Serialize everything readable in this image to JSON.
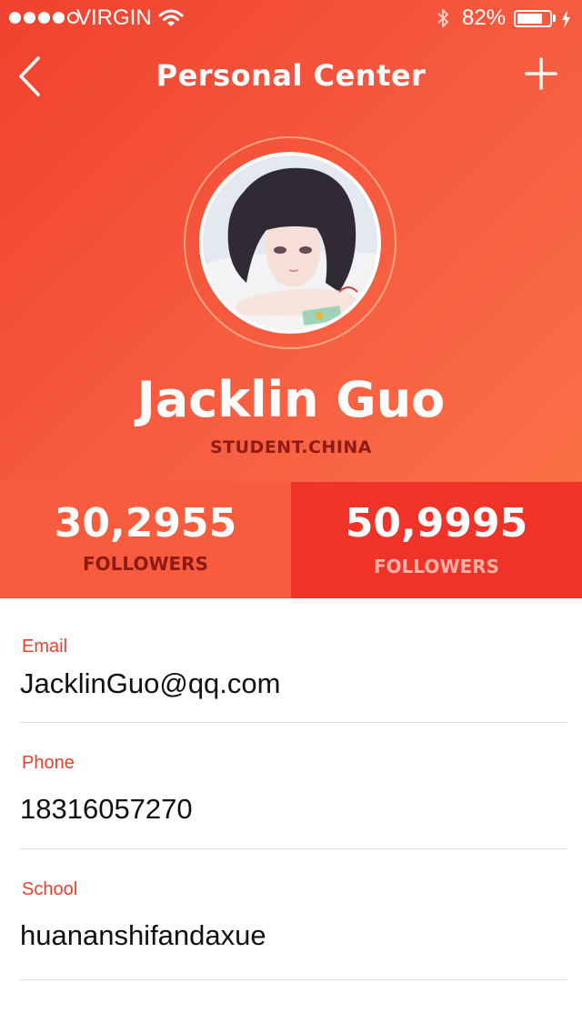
{
  "status_bar": {
    "carrier": "VIRGIN",
    "signal_bars_filled": 4,
    "signal_bars_total": 5,
    "battery_percent_text": "82%",
    "battery_level": 0.82
  },
  "nav": {
    "title": "Personal Center",
    "back_icon": "chevron-left-icon",
    "add_icon": "plus-icon"
  },
  "profile": {
    "name": "Jacklin Guo",
    "subtitle": "STUDENT.CHINA"
  },
  "stats": [
    {
      "value": "30,2955",
      "label": "FOLLOWERS"
    },
    {
      "value": "50,9995",
      "label": "FOLLOWERS"
    }
  ],
  "info": [
    {
      "label": "Email",
      "value": "JacklinGuo@qq.com"
    },
    {
      "label": "Phone",
      "value": "18316057270"
    },
    {
      "label": "School",
      "value": "huananshifandaxue"
    }
  ],
  "colors": {
    "accent": "#f0412f",
    "accent_light": "#fb7047",
    "stat_left_bg": "#f75c3e",
    "stat_right_bg": "#ef3329",
    "label_red": "#e6402d",
    "subtitle_dark_red": "#8e1a14"
  }
}
